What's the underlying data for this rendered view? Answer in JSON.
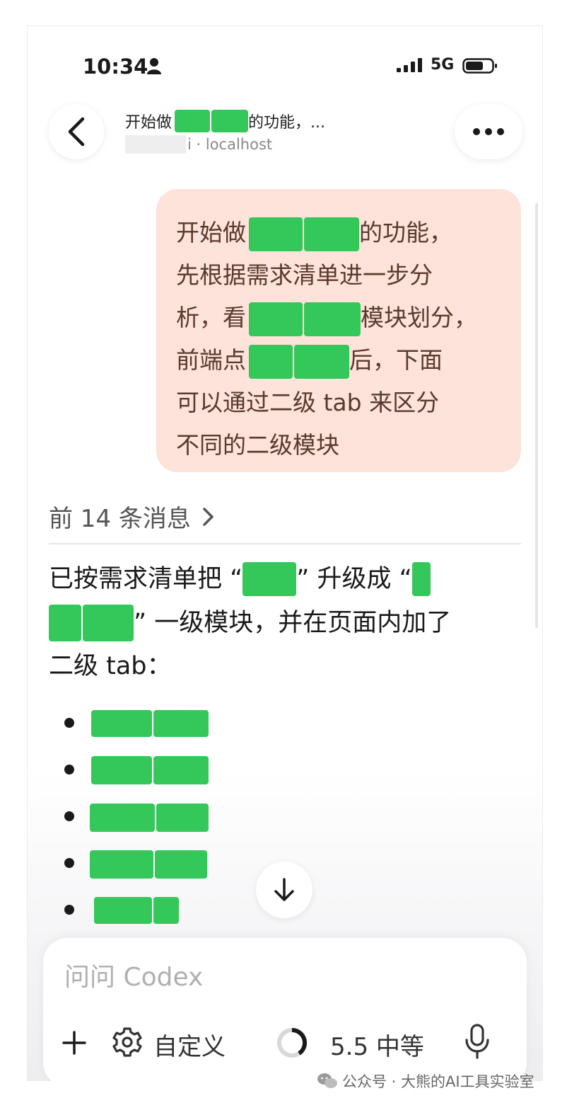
{
  "status_bar": {
    "time": "10:34",
    "network": "5G"
  },
  "header": {
    "title_prefix": "开始做",
    "title_suffix": "的功能，...",
    "subtitle_host": "i · localhost"
  },
  "user_message": {
    "lines": [
      {
        "before": "开始做",
        "after": "的功能，"
      },
      {
        "text": "先根据需求清单进一步分"
      },
      {
        "before": "析，看",
        "after": "模块划分，"
      },
      {
        "before": "前端点",
        "after": "后，下面"
      },
      {
        "text": "可以通过二级 tab 来区分"
      },
      {
        "text": "不同的二级模块"
      }
    ]
  },
  "previous_messages": {
    "label": "前 14 条消息"
  },
  "assistant_reply": {
    "line1_before": "已按需求清单把 “",
    "line1_mid": "” 升级成 “",
    "line2_after": "” 一级模块，并在页面内加了",
    "line3": "二级 tab："
  },
  "composer": {
    "placeholder": "问问 Codex",
    "custom_label": "自定义",
    "model_label": "5.5 中等"
  },
  "watermark": {
    "text": "公众号 · 大熊的AI工具实验室"
  },
  "colors": {
    "bubble": "#fde3da",
    "redaction": "#34c759"
  },
  "icons": [
    "person-icon",
    "signal-icon",
    "battery-icon",
    "back-arrow-icon",
    "more-icon",
    "chevron-right-icon",
    "arrow-down-icon",
    "plus-icon",
    "gear-icon",
    "progress-ring-icon",
    "mic-icon",
    "wechat-icon"
  ]
}
